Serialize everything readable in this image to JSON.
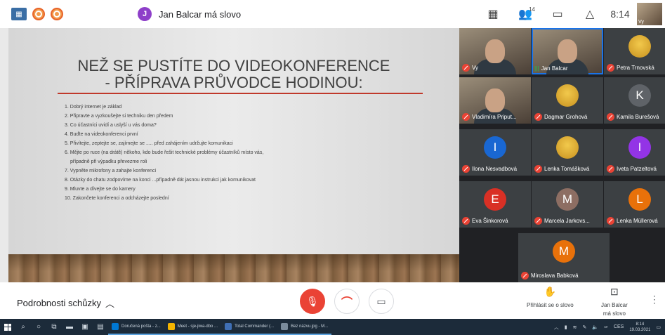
{
  "top": {
    "presenter_initial": "J",
    "presenter_text": "Jan Balcar má slovo",
    "participants_count": "14",
    "time": "8:14",
    "self_label": "Vy",
    "colors": {
      "presenter_avatar": "#8e3fc9"
    }
  },
  "slide": {
    "title_line1": "NEŽ SE PUSTÍTE DO VIDEOKONFERENCE",
    "title_line2": "- PŘÍPRAVA PRŮVODCE HODINOU:",
    "items": [
      "1. Dobrý internet je základ",
      "2. Připravte a vyzkoušejte si techniku den předem",
      "3. Co účastníci uvidí a uslyší u vás doma?",
      "4. Buďte na videokonferenci první",
      "5. Přivítejte, zeptejte se, zajímejte se ..... před zahájením udržujte komunikaci",
      "6. Mějte po ruce (na drátě) někoho, kdo bude řešit technické problémy účastníků místo vás,",
      "    případně při výpadku převezme roli",
      "7. Vypněte mikrofony a zahajte konferenci",
      "8. Otázky do chatu zodpovíme na konci ...případně dát jasnou instrukci jak komunikovat",
      "9. Mluvte a dívejte se do kamery",
      "10. Zakončete konferenci a odcházejte poslední"
    ]
  },
  "participants": [
    {
      "name": "Vy",
      "kind": "video",
      "muted": true
    },
    {
      "name": "Jan Balcar",
      "kind": "video",
      "muted": false,
      "speaking": true
    },
    {
      "name": "Petra Trnovská",
      "kind": "photo",
      "muted": true
    },
    {
      "name": "Vladimíra Priput...",
      "kind": "video",
      "muted": true
    },
    {
      "name": "Dagmar Grohová",
      "kind": "photo",
      "muted": true
    },
    {
      "name": "Kamila Burešová",
      "kind": "initial",
      "initial": "K",
      "color": "#5f6368",
      "muted": true
    },
    {
      "name": "Ilona Nesvadbová",
      "kind": "initial",
      "initial": "I",
      "color": "#1967d2",
      "muted": true
    },
    {
      "name": "Lenka Tomášková",
      "kind": "photo",
      "muted": true
    },
    {
      "name": "Iveta Patzeltová",
      "kind": "initial",
      "initial": "I",
      "color": "#9334e6",
      "muted": true
    },
    {
      "name": "Eva Šinkorová",
      "kind": "initial",
      "initial": "E",
      "color": "#d93025",
      "muted": true
    },
    {
      "name": "Marcela Jarkovs...",
      "kind": "initial",
      "initial": "M",
      "color": "#8d6e63",
      "muted": true
    },
    {
      "name": "Lenka Müllerová",
      "kind": "initial",
      "initial": "L",
      "color": "#e8710a",
      "muted": true
    },
    {
      "name": "Miroslava Babková",
      "kind": "initial",
      "initial": "M",
      "color": "#e8710a",
      "muted": true
    }
  ],
  "bottom": {
    "details_label": "Podrobnosti schůzky",
    "raise_hand": "Přihlásit se o slovo",
    "presenter_line1": "Jan Balcar",
    "presenter_line2": "má slovo"
  },
  "taskbar": {
    "apps": [
      {
        "label": "Doručená pošta - z...",
        "color": "#0078d4"
      },
      {
        "label": "Meet - sje-jiwa-dbo ...",
        "color": "#f4b400"
      },
      {
        "label": "Total Commander (...",
        "color": "#3f6fb5"
      },
      {
        "label": "Bez názvu.jpg - M...",
        "color": "#7a8b9c"
      }
    ],
    "lang": "CES",
    "time": "8:14",
    "date": "19.03.2021"
  }
}
